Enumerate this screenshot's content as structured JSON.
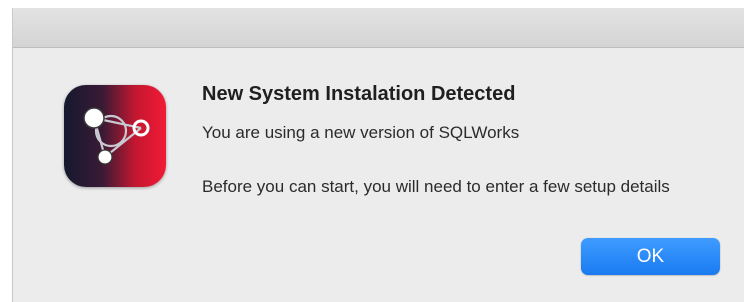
{
  "dialog": {
    "title": "New System Instalation Detected",
    "message_line1": "You are using a new version of SQLWorks",
    "message_line2": "Before you can start, you will need to enter a few setup details",
    "ok_label": "OK"
  },
  "icons": {
    "app_icon": "sqlworks-app-icon"
  },
  "colors": {
    "accent_button": "#1a7bf1",
    "icon_gradient_start": "#14192f",
    "icon_gradient_end": "#f21a36",
    "dialog_background": "#ececec"
  }
}
